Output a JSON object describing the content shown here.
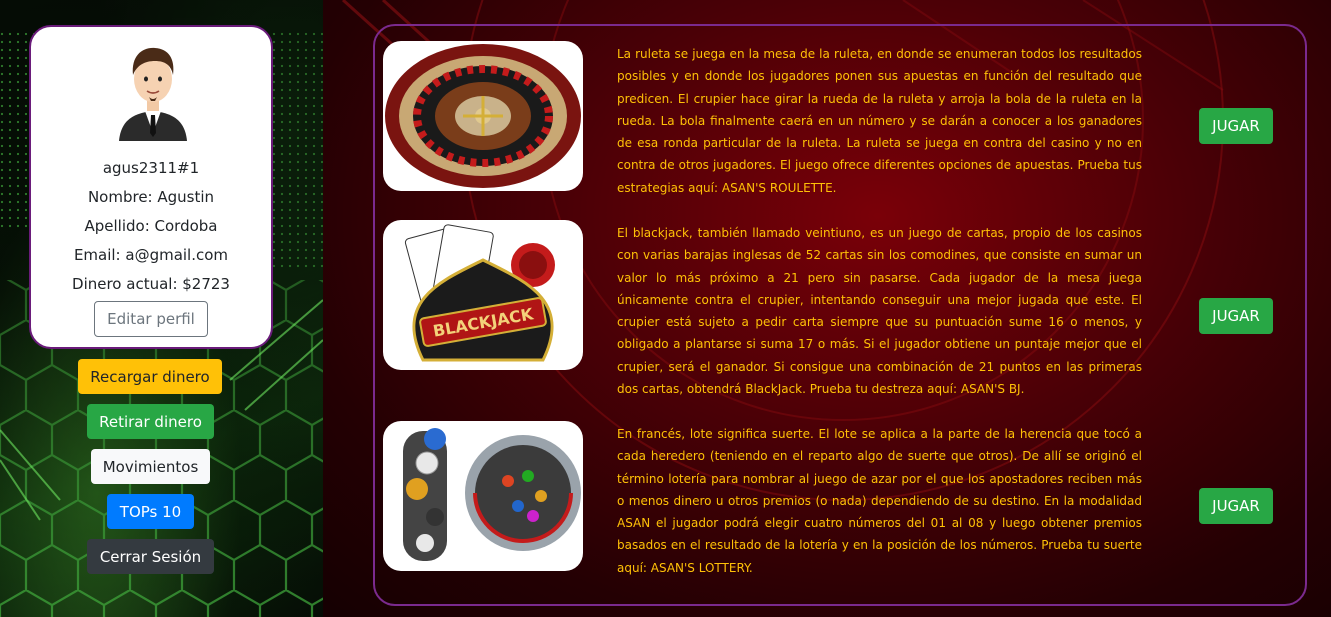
{
  "profile": {
    "username": "agus2311#1",
    "name": "Nombre: Agustin",
    "surname": "Apellido: Cordoba",
    "email": "Email: a@gmail.com",
    "balance": "Dinero actual: $2723",
    "edit_label": "Editar perfil"
  },
  "sidebar": {
    "buttons": [
      {
        "label": "Recargar dinero",
        "color": "#ffc107"
      },
      {
        "label": "Retirar dinero",
        "color": "#28a745"
      },
      {
        "label": "Movimientos",
        "color": "#f8f9fa"
      },
      {
        "label": "TOPs 10",
        "color": "#007bff"
      },
      {
        "label": "Cerrar Sesión",
        "color": "#343a40"
      }
    ]
  },
  "games": [
    {
      "image": "roulette-wheel",
      "description": "La ruleta se juega en la mesa de la ruleta, en donde se enumeran todos los resultados posibles y en donde los jugadores ponen sus apuestas en función del resultado que predicen. El crupier hace girar la rueda de la ruleta y arroja la bola de la ruleta en la rueda. La bola finalmente caerá en un número y se darán a conocer a los ganadores de esa ronda particular de la ruleta. La ruleta se juega en contra del casino y no en contra de otros jugadores. El juego ofrece diferentes opciones de apuestas. Prueba tus estrategias aquí: ASAN'S ROULETTE.",
      "button": "JUGAR"
    },
    {
      "image": "blackjack-cards",
      "description": "El blackjack, también llamado veintiuno, es un juego de cartas, propio de los casinos con varias barajas inglesas de 52 cartas sin los comodines, que consiste en sumar un valor lo más próximo a 21 pero sin pasarse. Cada jugador de la mesa juega únicamente contra el crupier, intentando conseguir una mejor jugada que este. El crupier está sujeto a pedir carta siempre que su puntuación sume 16 o menos, y obligado a plantarse si suma 17 o más. Si el jugador obtiene un puntaje mejor que el crupier, será el ganador. Si consigue una combinación de 21 puntos en las primeras dos cartas, obtendrá BlackJack. Prueba tu destreza aquí: ASAN'S BJ.",
      "button": "JUGAR"
    },
    {
      "image": "lottery-machine",
      "description": "En francés, lote significa suerte. El lote se aplica a la parte de la herencia que tocó a cada heredero (teniendo en el reparto algo de suerte que otros). De allí se originó el término lotería para nombrar al juego de azar por el que los apostadores reciben más o menos dinero u otros premios (o nada) dependiendo de su destino. En la modalidad ASAN el jugador podrá elegir cuatro números del 01 al 08 y luego obtener premios basados en el resultado de la lotería y en la posición de los números. Prueba tu suerte aquí: ASAN'S LOTTERY.",
      "button": "JUGAR"
    }
  ],
  "colors": {
    "accent_text": "#ffc107",
    "panel_border": "#7b2a8e",
    "play_button": "#28a745"
  }
}
